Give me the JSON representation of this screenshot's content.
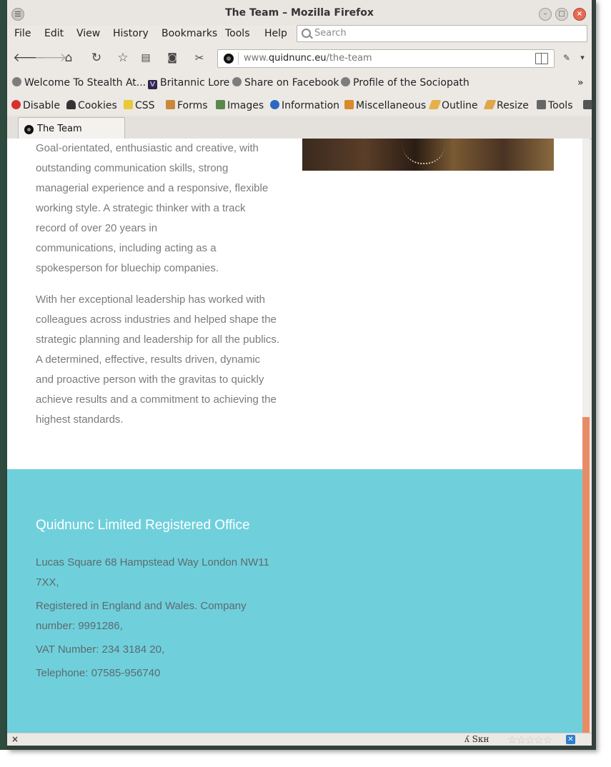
{
  "window": {
    "title": "The Team – Mozilla Firefox"
  },
  "menubar": {
    "items": [
      "File",
      "Edit",
      "View",
      "History",
      "Bookmarks",
      "Tools",
      "Help"
    ]
  },
  "search": {
    "placeholder": "Search"
  },
  "urlbar": {
    "prefix": "www.",
    "domain": "quidnunc.eu",
    "path": "/the-team"
  },
  "bookmarks": {
    "items": [
      "Welcome To Stealth At...",
      "Britannic Lore",
      "Share on Facebook",
      "Profile of the Sociopath"
    ],
    "overflow": "»"
  },
  "devtoolbar": {
    "items": [
      "Disable",
      "Cookies",
      "CSS",
      "Forms",
      "Images",
      "Information",
      "Miscellaneous",
      "Outline",
      "Resize",
      "Tools"
    ]
  },
  "tab": {
    "label": "The Team"
  },
  "content": {
    "para1": "Goal-orientated, enthusiastic and creative, with\noutstanding communication skills, strong\nmanagerial experience and a responsive, flexible\nworking style.  A strategic thinker with a track\nrecord of over 20 years in\ncommunications, including acting as a\nspokesperson for bluechip companies.",
    "para2": "With her exceptional leadership has worked with\ncolleagues across industries and helped shape the\nstrategic planning and leadership for all the publics.\n A determined, effective, results driven, dynamic\nand proactive person with the gravitas to quickly\nachieve results and a commitment to achieving the\nhighest standards."
  },
  "footer": {
    "title": "Quidnunc Limited Registered Office",
    "address": "Lucas Square 68 Hampstead Way London NW11\n7XX,",
    "registration": "Registered in England and Wales. Company\nnumber: 9991286,",
    "vat": "VAT Number: 234 3184 20,",
    "telephone": "Telephone: 07585-956740"
  },
  "statusbar": {
    "close": "×",
    "lang": "ʎ Sкн"
  },
  "colors": {
    "footer_bg": "#6fd0dc",
    "scroll_thumb": "#e88c68",
    "body_text": "#7b7b7b"
  }
}
